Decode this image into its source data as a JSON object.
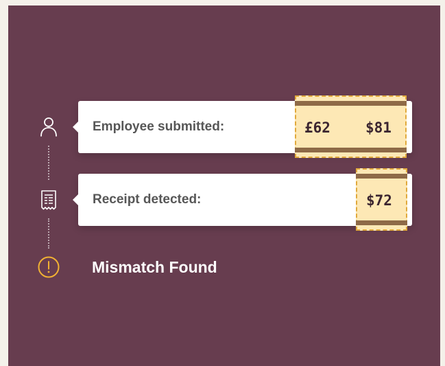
{
  "timeline": {
    "step_employee": {
      "icon": "person-icon",
      "label": "Employee submitted:",
      "amounts": [
        "£62",
        "$81"
      ]
    },
    "step_receipt": {
      "icon": "receipt-icon",
      "label": "Receipt detected:",
      "amounts": [
        "$72"
      ]
    },
    "step_result": {
      "icon": "alert-icon",
      "label": "Mismatch Found"
    }
  },
  "colors": {
    "background": "#f4f1ea",
    "panel": "#673d4f",
    "highlight_fill": "#fde8b5",
    "highlight_border": "#e0a93c",
    "alert": "#f2b233",
    "card": "#ffffff"
  }
}
